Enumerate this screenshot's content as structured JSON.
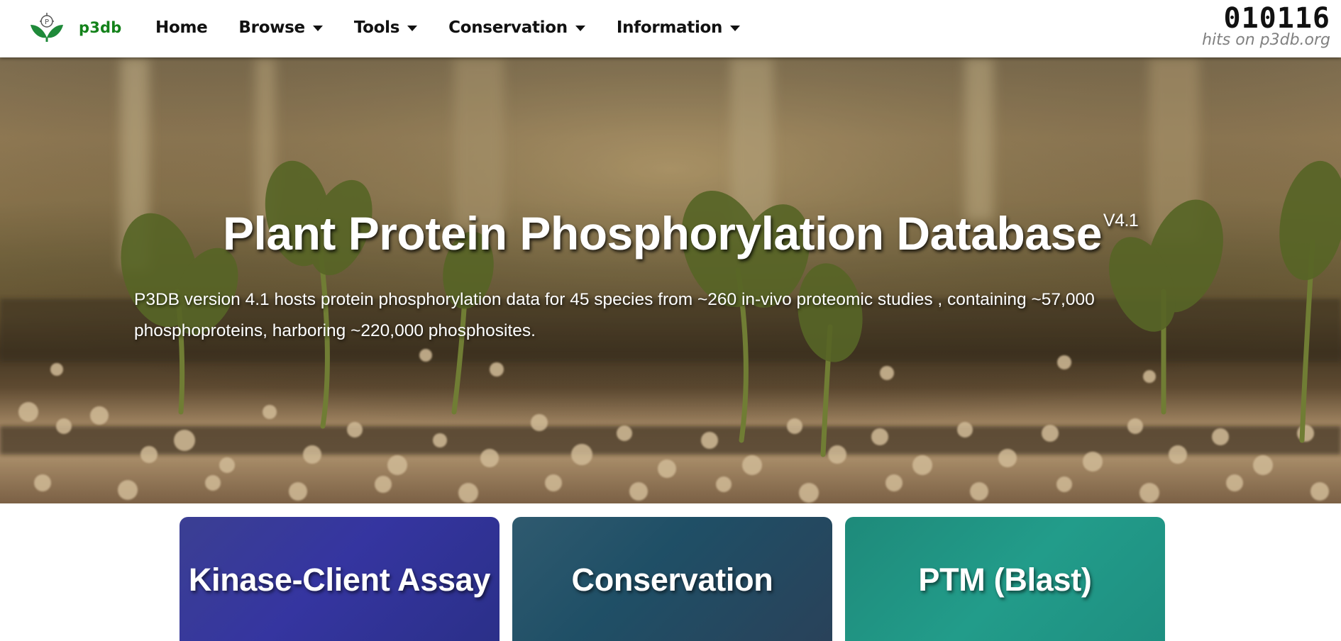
{
  "brand": {
    "name": "p3db",
    "logo_icon": "leaf-logo-icon",
    "brand_color": "#13821a"
  },
  "nav": {
    "items": [
      {
        "label": "Home",
        "has_dropdown": false
      },
      {
        "label": "Browse",
        "has_dropdown": true
      },
      {
        "label": "Tools",
        "has_dropdown": true
      },
      {
        "label": "Conservation",
        "has_dropdown": true
      },
      {
        "label": "Information",
        "has_dropdown": true
      }
    ]
  },
  "counter": {
    "value": "010116",
    "label": "hits on p3db.org"
  },
  "hero": {
    "title": "Plant Protein Phosphorylation Database",
    "version": "V4.1",
    "description": "P3DB version 4.1 hosts protein phosphorylation data for 45 species from ~260 in-vivo proteomic studies , containing ~57,000 phosphoproteins, harboring ~220,000 phosphosites."
  },
  "cards": [
    {
      "label": "Kinase-Client Assay",
      "color": "#3535a0"
    },
    {
      "label": "Conservation",
      "color": "#1f4f66"
    },
    {
      "label": "PTM (Blast)",
      "color": "#229c8a"
    }
  ]
}
